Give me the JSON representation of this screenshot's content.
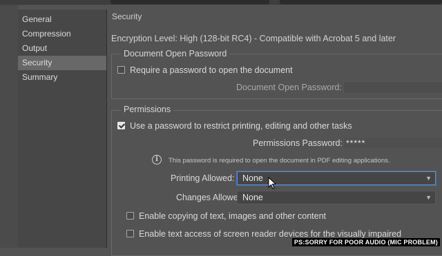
{
  "sidebar": {
    "items": [
      {
        "label": "General"
      },
      {
        "label": "Compression"
      },
      {
        "label": "Output"
      },
      {
        "label": "Security"
      },
      {
        "label": "Summary"
      }
    ],
    "active": "Security"
  },
  "panel": {
    "heading": "Security",
    "encryption_level": "Encryption Level: High (128-bit RC4) - Compatible with Acrobat 5 and later"
  },
  "open_password": {
    "legend": "Document Open Password",
    "checkbox_label": "Require a password to open the document",
    "checked": false,
    "field_label": "Document Open Password:",
    "field_value": ""
  },
  "permissions": {
    "legend": "Permissions",
    "checkbox_label": "Use a password to restrict printing, editing and other tasks",
    "checked": true,
    "password_label": "Permissions Password:",
    "password_value": "*****",
    "info_icon": "info-circle-icon",
    "note": "This password is required to open the document in PDF editing applications.",
    "printing_label": "Printing Allowed:",
    "printing_value": "None",
    "changes_label": "Changes Allowed:",
    "changes_value": "None",
    "copy_label": "Enable copying of text, images and other content",
    "copy_checked": false,
    "access_label": "Enable text access of screen reader devices for the visually impaired",
    "access_checked": false
  },
  "overlay_caption": "PS:SORRY FOR POOR AUDIO (MIC PROBLEM)",
  "colors": {
    "background": "#535353",
    "sidebar": "#474747",
    "sidebar_active": "#686868",
    "focus_border": "#5a8dd6"
  }
}
